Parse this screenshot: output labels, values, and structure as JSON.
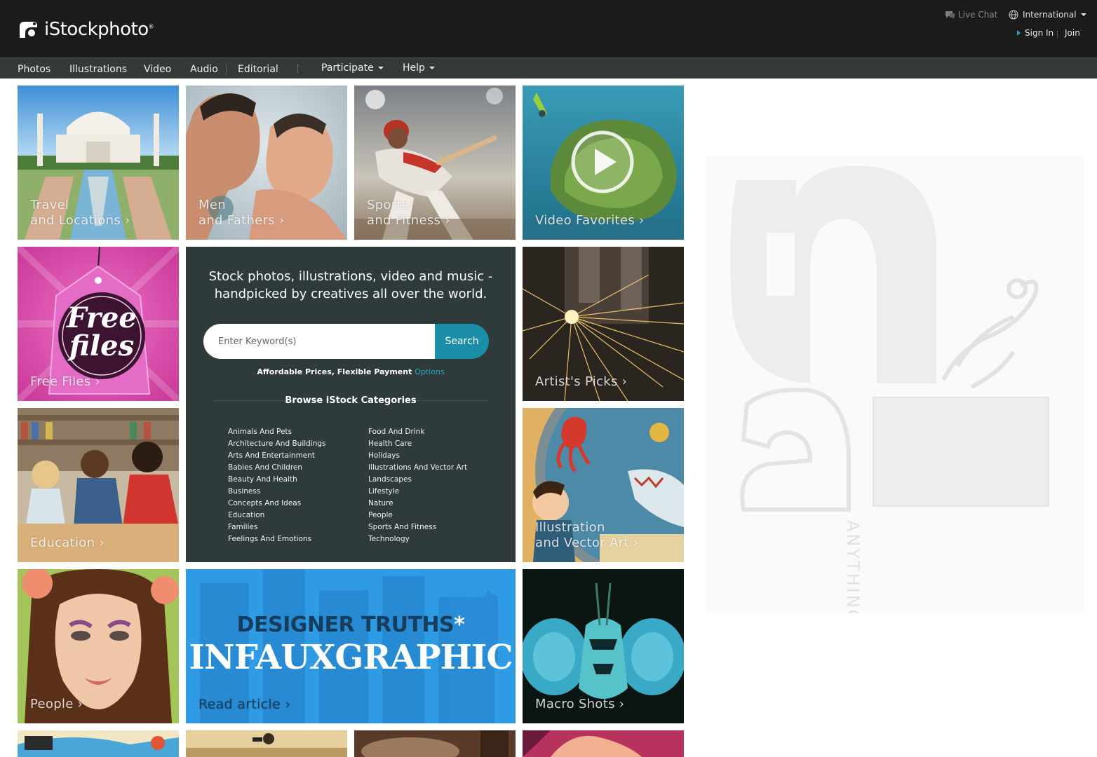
{
  "header": {
    "logo_text": "iStockphoto",
    "logo_reg": "®",
    "live_chat": "Live Chat",
    "region": "International",
    "sign_in": "Sign In",
    "join": "Join"
  },
  "nav": {
    "items": [
      "Photos",
      "Illustrations",
      "Video",
      "Audio",
      "Editorial"
    ],
    "participate": "Participate",
    "help": "Help"
  },
  "tiles": {
    "travel": [
      "Travel",
      "and Locations ›"
    ],
    "men": [
      "Men",
      "and Fathers ›"
    ],
    "sports": [
      "Sports",
      "and Fitness ›"
    ],
    "video": "Video Favorites ›",
    "free": "Free Files ›",
    "free_tag_line1": "Free",
    "free_tag_line2": "files",
    "artists": "Artist's Picks ›",
    "education": "Education ›",
    "illustration": [
      "Illustration",
      "and Vector Art ›"
    ],
    "people": "People ›",
    "designer_line1": "DESIGNER TRUTHS",
    "designer_star": "*",
    "designer_line2": "INFAUXGRAPHIC",
    "read_article": "Read article ›",
    "macro": "Macro Shots ›"
  },
  "panel": {
    "tagline_1": "Stock photos, illustrations, video and music -",
    "tagline_2": "handpicked by creatives all over the world.",
    "search_placeholder": "Enter Keyword(s)",
    "search_button": "Search",
    "afford_text": "Affordable Prices, Flexible Payment",
    "afford_link": "Options",
    "browse_title": "Browse iStock Categories",
    "categories_left": [
      "Animals And Pets",
      "Architecture And Buildings",
      "Arts And Entertainment",
      "Babies And Children",
      "Beauty And Health",
      "Business",
      "Concepts And Ideas",
      "Education",
      "Families",
      "Feelings And Emotions"
    ],
    "categories_right": [
      "Food And Drink",
      "Health Care",
      "Holidays",
      "Illustrations And Vector Art",
      "Landscapes",
      "Lifestyle",
      "Nature",
      "People",
      "Sports And Fitness",
      "Technology"
    ]
  },
  "ad": {
    "vertical_text": "ANYTHING."
  },
  "colors": {
    "topbar": "#1b1b1b",
    "navbar": "#34393a",
    "panel": "#2f3a3a",
    "accent": "#1c8fa8"
  }
}
